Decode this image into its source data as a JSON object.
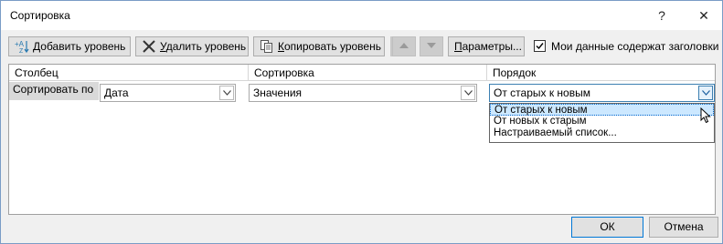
{
  "window": {
    "title": "Сортировка",
    "help_glyph": "?",
    "close_glyph": "✕"
  },
  "toolbar": {
    "add_level_u": "Д",
    "add_level_rest": "обавить уровень",
    "delete_level_u": "У",
    "delete_level_rest": "далить уровень",
    "copy_level_u": "К",
    "copy_level_rest": "опировать уровень",
    "options_u": "П",
    "options_rest": "араметры...",
    "headers_checkbox_label": "Мои данные содержат заголовки",
    "headers_checked": true
  },
  "grid": {
    "headers": [
      "Столбец",
      "Сортировка",
      "Порядок"
    ],
    "row_label": "Сортировать по",
    "column_value": "Дата",
    "sort_on_value": "Значения",
    "order_value": "От старых к новым",
    "order_options": [
      "От старых к новым",
      "От новых к старым",
      "Настраиваемый список..."
    ]
  },
  "footer": {
    "ok_label": "ОК",
    "cancel_label": "Отмена"
  },
  "icons": [
    "add-level-icon",
    "delete-level-icon",
    "copy-level-icon",
    "move-up-icon",
    "move-down-icon",
    "chevron-down-icon",
    "mouse-cursor-icon"
  ]
}
